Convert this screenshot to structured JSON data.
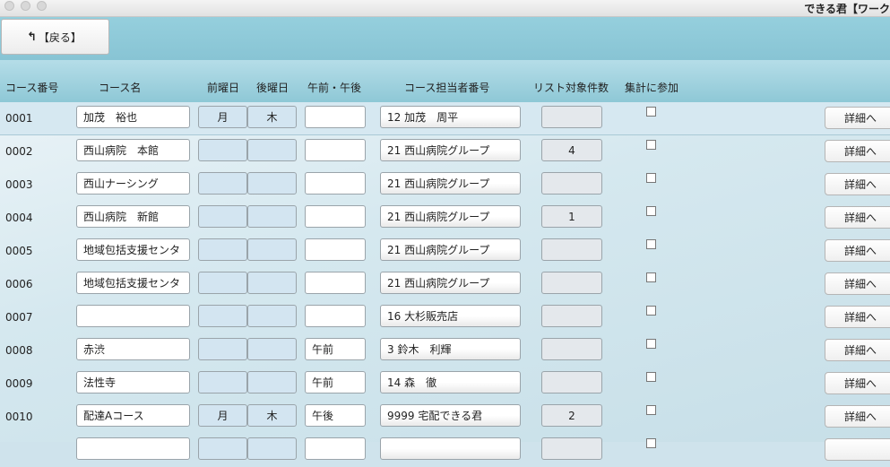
{
  "window": {
    "title": "できる君【ワーク"
  },
  "toolbar": {
    "back_label": "【戻る】",
    "back_icon": "back-arrow-icon"
  },
  "columns": {
    "course_no": "コース番号",
    "course_name": "コース名",
    "prev_day": "前曜日",
    "next_day": "後曜日",
    "am_pm": "午前・午後",
    "staff_no": "コース担当者番号",
    "list_count": "リスト対象件数",
    "aggregate": "集計に参加"
  },
  "detail_label": "詳細へ",
  "rows": [
    {
      "no": "0001",
      "name": "加茂　裕也",
      "prev": "月",
      "next": "木",
      "ampm": "",
      "staff": "12 加茂　周平",
      "count": "",
      "checked": false
    },
    {
      "no": "0002",
      "name": "西山病院　本館",
      "prev": "",
      "next": "",
      "ampm": "",
      "staff": "21 西山病院グループ",
      "count": "4",
      "checked": false
    },
    {
      "no": "0003",
      "name": "西山ナーシング",
      "prev": "",
      "next": "",
      "ampm": "",
      "staff": "21 西山病院グループ",
      "count": "",
      "checked": false
    },
    {
      "no": "0004",
      "name": "西山病院　新館",
      "prev": "",
      "next": "",
      "ampm": "",
      "staff": "21 西山病院グループ",
      "count": "1",
      "checked": false
    },
    {
      "no": "0005",
      "name": "地域包括支援センタ",
      "prev": "",
      "next": "",
      "ampm": "",
      "staff": "21 西山病院グループ",
      "count": "",
      "checked": false
    },
    {
      "no": "0006",
      "name": "地域包括支援センタ",
      "prev": "",
      "next": "",
      "ampm": "",
      "staff": "21 西山病院グループ",
      "count": "",
      "checked": false
    },
    {
      "no": "0007",
      "name": "",
      "prev": "",
      "next": "",
      "ampm": "",
      "staff": "16 大杉販売店",
      "count": "",
      "checked": false
    },
    {
      "no": "0008",
      "name": "赤渋",
      "prev": "",
      "next": "",
      "ampm": "午前",
      "staff": "3 鈴木　利輝",
      "count": "",
      "checked": false
    },
    {
      "no": "0009",
      "name": "法性寺",
      "prev": "",
      "next": "",
      "ampm": "午前",
      "staff": "14 森　徹",
      "count": "",
      "checked": false
    },
    {
      "no": "0010",
      "name": "配達Aコース",
      "prev": "月",
      "next": "木",
      "ampm": "午後",
      "staff": "9999 宅配できる君",
      "count": "2",
      "checked": false
    },
    {
      "no": "",
      "name": "",
      "prev": "",
      "next": "",
      "ampm": "",
      "staff": "",
      "count": "",
      "checked": false
    }
  ]
}
